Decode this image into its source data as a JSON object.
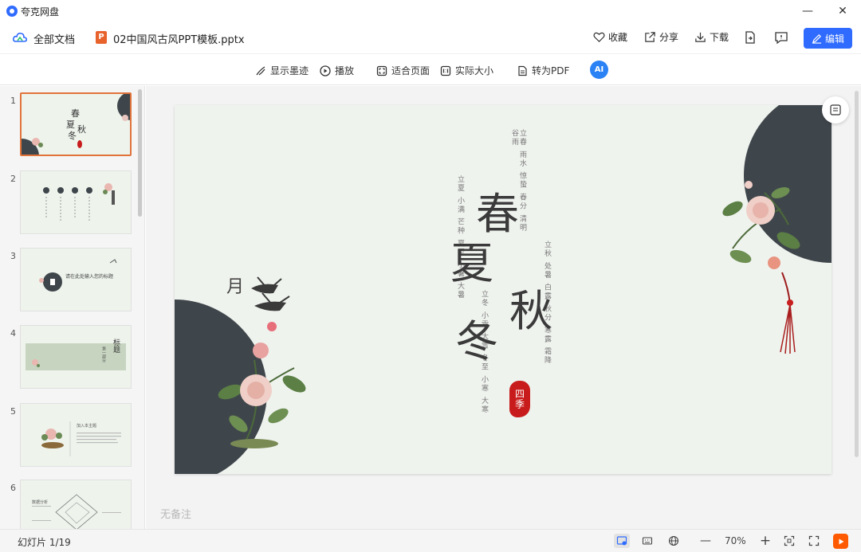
{
  "app": {
    "title": "夸克网盘"
  },
  "window": {
    "minimize": "—",
    "maximize": "☐",
    "close": "✕"
  },
  "header": {
    "all_docs_label": "全部文档",
    "file_badge": "P",
    "file_name": "02中国风古风PPT模板.pptx",
    "favorite_label": "收藏",
    "share_label": "分享",
    "download_label": "下载",
    "edit_label": "编辑"
  },
  "toolbar": {
    "show_ink_label": "显示墨迹",
    "play_label": "播放",
    "fit_page_label": "适合页面",
    "actual_size_label": "实际大小",
    "to_pdf_label": "转为PDF",
    "ai_label": "AI"
  },
  "sidebar": {
    "slides": [
      {
        "number": "1",
        "active": true
      },
      {
        "number": "2",
        "active": false
      },
      {
        "number": "3",
        "active": false
      },
      {
        "number": "4",
        "active": false
      },
      {
        "number": "5",
        "active": false
      },
      {
        "number": "6",
        "active": false
      }
    ],
    "thumb3_text": "请在此处输入您的标题",
    "thumb4_title": "标题",
    "thumb4_sub": "第一部分",
    "thumb5_text": "加入本主题",
    "thumb6_text": "数据分析"
  },
  "slide": {
    "big_chars": {
      "chun": "春",
      "xia": "夏",
      "qiu": "秋",
      "dong": "冬"
    },
    "col_spring": "立春 雨水 惊蛰 春分 清明 谷雨",
    "col_summer": "立夏 小满 芒种 夏至 小暑 大暑",
    "col_autumn": "立秋 处暑 白露 秋分 寒露 霜降",
    "col_winter": "立冬 小雪 大雪 冬至 小寒 大寒",
    "seal_text": "四季",
    "yue": "月",
    "colors": {
      "dark_circle": "#3f464b",
      "seal": "#c81b1b",
      "bg": "#eff3ee"
    }
  },
  "main": {
    "notes_placeholder": "无备注"
  },
  "status": {
    "slide_count": "幻灯片 1/19",
    "zoom": "70%",
    "zoom_out": "—",
    "zoom_in": "+"
  }
}
